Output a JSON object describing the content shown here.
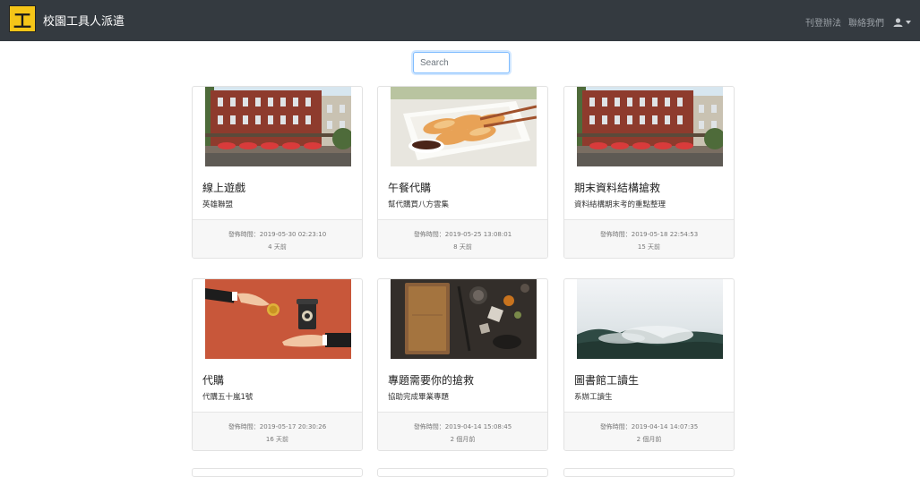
{
  "navbar": {
    "brand": "校園工具人派遣",
    "links": [
      "刊登辦法",
      "聯絡我們"
    ]
  },
  "search": {
    "placeholder": "Search"
  },
  "cards": [
    {
      "title": "線上遊戲",
      "desc": "英雄聯盟",
      "post_time": "發佈時間：2019-05-30 02:23:10",
      "rel_time": "4 天前",
      "image": "street-buildings"
    },
    {
      "title": "午餐代購",
      "desc": "幫代購買八方雲集",
      "post_time": "發佈時間：2019-05-25 13:08:01",
      "rel_time": "8 天前",
      "image": "dumplings-plate"
    },
    {
      "title": "期末資料結構搶救",
      "desc": "資料結構期末考的重點整理",
      "post_time": "發佈時間：2019-05-18 22:54:53",
      "rel_time": "15 天前",
      "image": "street-buildings"
    },
    {
      "title": "代購",
      "desc": "代購五十嵐1號",
      "post_time": "發佈時間：2019-05-17 20:30:26",
      "rel_time": "16 天前",
      "image": "coin-exchange"
    },
    {
      "title": "專題需要你的搶救",
      "desc": "協助完成畢業專題",
      "post_time": "發佈時間：2019-04-14 15:08:45",
      "rel_time": "2 個月前",
      "image": "desk-notebook"
    },
    {
      "title": "圖書館工讀生",
      "desc": "系辦工讀生",
      "post_time": "發佈時間：2019-04-14 14:07:35",
      "rel_time": "2 個月前",
      "image": "misty-forest"
    }
  ],
  "colors": {
    "navbar": "#343a40",
    "logo": "#f5c518",
    "page": "#ffffff"
  }
}
